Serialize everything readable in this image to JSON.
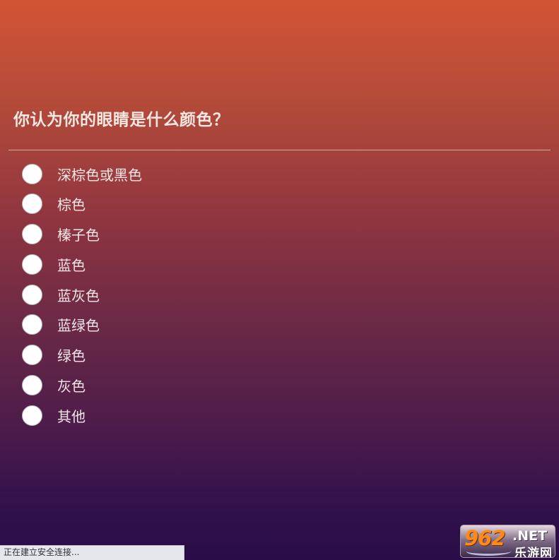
{
  "question": "你认为你的眼睛是什么颜色？",
  "options": [
    {
      "label": "深棕色或黑色"
    },
    {
      "label": "棕色"
    },
    {
      "label": "榛子色"
    },
    {
      "label": "蓝色"
    },
    {
      "label": "蓝灰色"
    },
    {
      "label": "蓝绿色"
    },
    {
      "label": "绿色"
    },
    {
      "label": "灰色"
    },
    {
      "label": "其他"
    }
  ],
  "status_bar": {
    "text": "正在建立安全连接..."
  },
  "watermark": {
    "number": "962",
    "domain": ".NET",
    "site_name": "乐游网"
  }
}
